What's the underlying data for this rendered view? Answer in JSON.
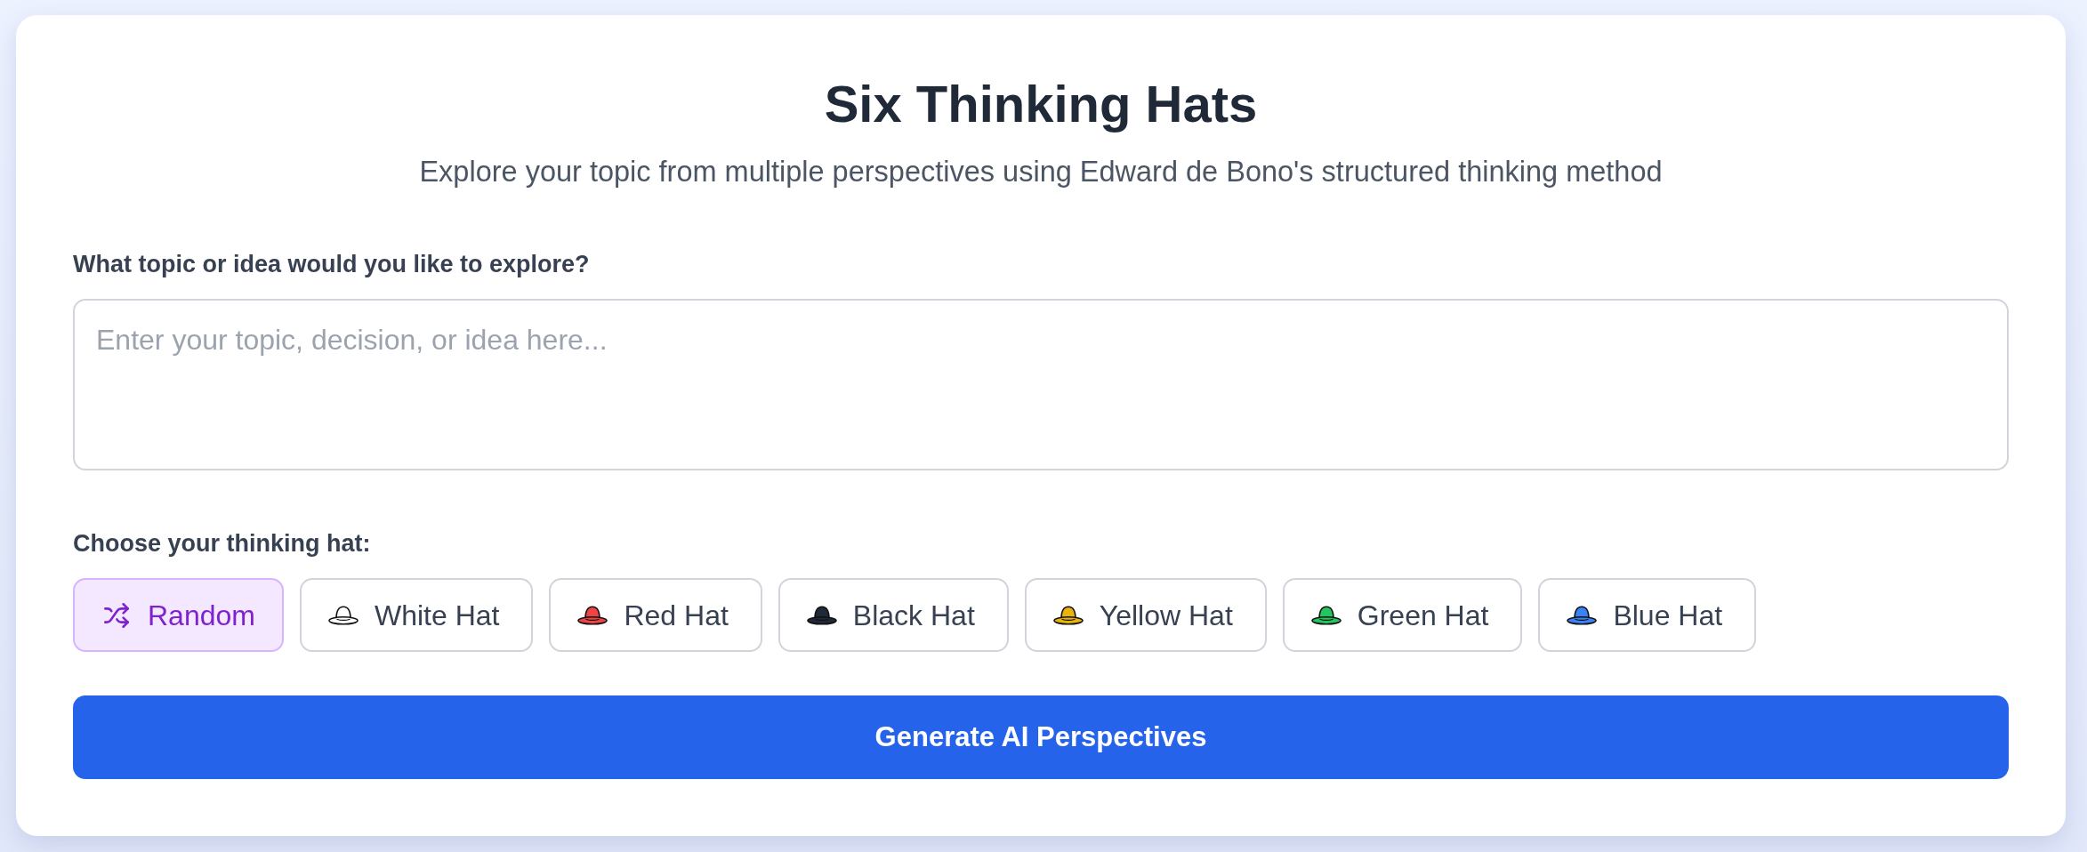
{
  "header": {
    "title": "Six Thinking Hats",
    "subtitle": "Explore your topic from multiple perspectives using Edward de Bono's structured thinking method"
  },
  "topic": {
    "label": "What topic or idea would you like to explore?",
    "placeholder": "Enter your topic, decision, or idea here..."
  },
  "hat_picker": {
    "label": "Choose your thinking hat:",
    "options": [
      {
        "kind": "random",
        "label": "Random",
        "selected": true
      },
      {
        "kind": "hat",
        "label": "White Hat",
        "selected": false,
        "color": "#ffffff"
      },
      {
        "kind": "hat",
        "label": "Red Hat",
        "selected": false,
        "color": "#ef4444"
      },
      {
        "kind": "hat",
        "label": "Black Hat",
        "selected": false,
        "color": "#1f2937"
      },
      {
        "kind": "hat",
        "label": "Yellow Hat",
        "selected": false,
        "color": "#eab308"
      },
      {
        "kind": "hat",
        "label": "Green Hat",
        "selected": false,
        "color": "#22c55e"
      },
      {
        "kind": "hat",
        "label": "Blue Hat",
        "selected": false,
        "color": "#3b82f6"
      }
    ]
  },
  "generate_button": {
    "label": "Generate AI Perspectives"
  }
}
